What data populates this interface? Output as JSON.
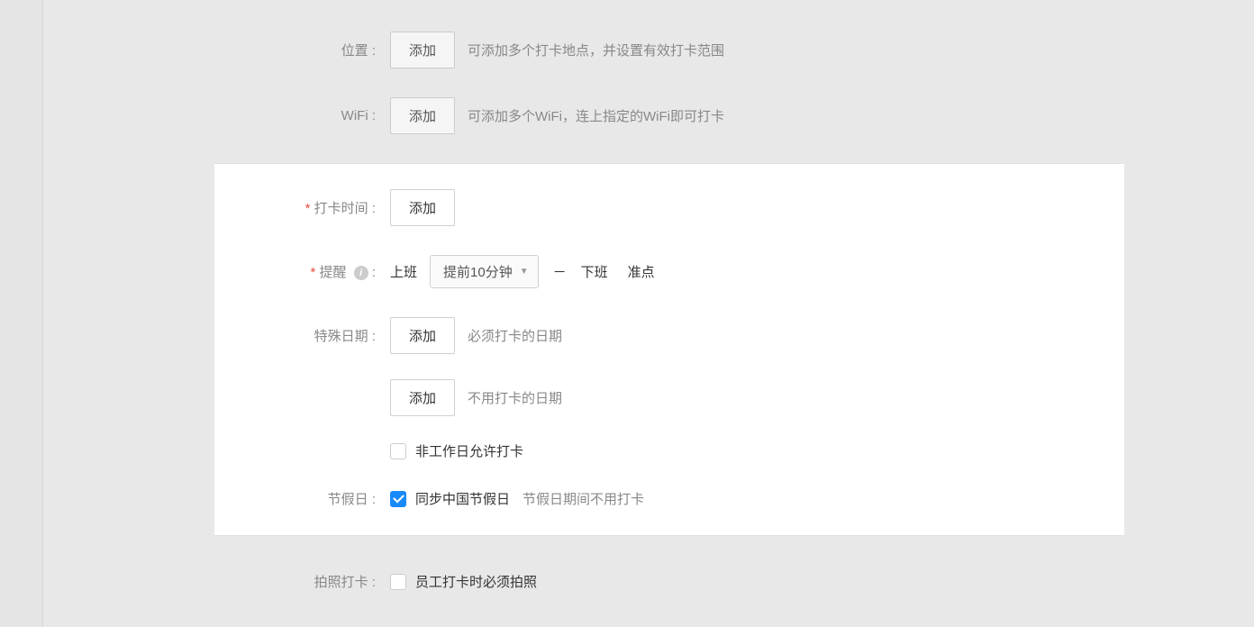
{
  "location": {
    "label": "位置 :",
    "button": "添加",
    "hint": "可添加多个打卡地点，并设置有效打卡范围"
  },
  "wifi": {
    "label": "WiFi :",
    "button": "添加",
    "hint": "可添加多个WiFi，连上指定的WiFi即可打卡"
  },
  "clock_time": {
    "label": "打卡时间 :",
    "button": "添加"
  },
  "reminder": {
    "label": "提醒",
    "label_suffix": " :",
    "before_work": "上班",
    "select_value": "提前10分钟",
    "separator": "－",
    "after_work": "下班",
    "on_time": "准点"
  },
  "special_date": {
    "label": "特殊日期 :",
    "button_must": "添加",
    "hint_must": "必须打卡的日期",
    "button_not": "添加",
    "hint_not": "不用打卡的日期",
    "non_workday_allow": "非工作日允许打卡"
  },
  "holiday": {
    "label": "节假日 :",
    "sync_label": "同步中国节假日",
    "hint": "节假日期间不用打卡"
  },
  "photo": {
    "label": "拍照打卡 :",
    "check_label": "员工打卡时必须拍照"
  }
}
